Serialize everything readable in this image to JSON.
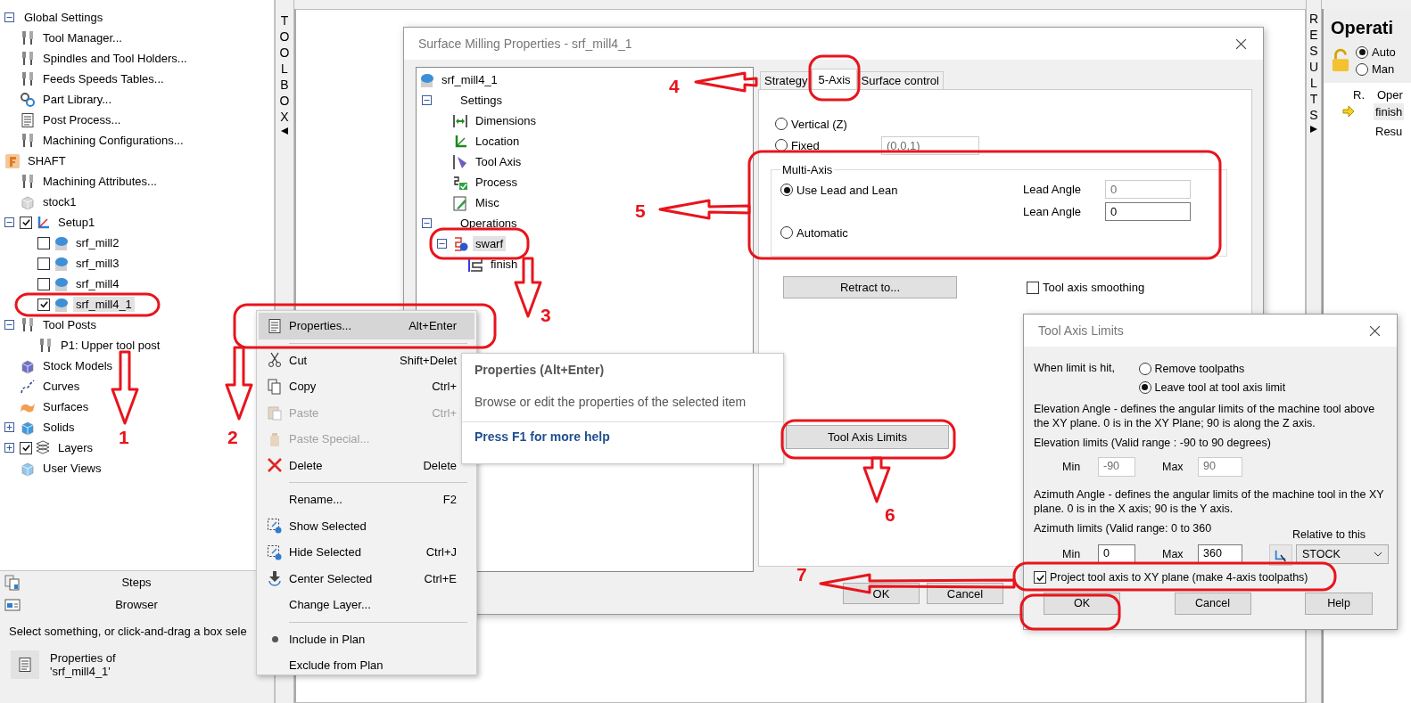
{
  "browser_panel": {
    "tree": [
      {
        "label": "Global Settings",
        "expanded": true,
        "selected": false,
        "children": [
          {
            "label": "Tool Manager...",
            "selected": false
          },
          {
            "label": "Spindles and Tool Holders...",
            "selected": false
          },
          {
            "label": "Feeds  Speeds Tables...",
            "selected": false
          },
          {
            "label": "Part Library...",
            "selected": false
          },
          {
            "label": "Post Process...",
            "selected": false
          },
          {
            "label": "Machining Configurations...",
            "selected": false
          }
        ]
      },
      {
        "label": "SHAFT",
        "selected": false,
        "children": [
          {
            "label": "Machining Attributes...",
            "selected": false
          },
          {
            "label": "stock1",
            "selected": false
          },
          {
            "label": "Setup1",
            "expanded": true,
            "checked": true,
            "selected": false,
            "children": [
              {
                "label": "srf_mill2",
                "checked": false,
                "selected": false
              },
              {
                "label": "srf_mill3",
                "checked": false,
                "selected": false
              },
              {
                "label": "srf_mill4",
                "checked": false,
                "selected": false
              },
              {
                "label": "srf_mill4_1",
                "checked": true,
                "selected": true
              }
            ]
          },
          {
            "label": "Tool Posts",
            "expanded": true,
            "selected": false,
            "children": [
              {
                "label": "P1: Upper tool post",
                "selected": false
              }
            ]
          },
          {
            "label": "Stock Models",
            "selected": false
          },
          {
            "label": "Curves",
            "selected": false
          },
          {
            "label": "Surfaces",
            "selected": false
          },
          {
            "label": "Solids",
            "expanded": false,
            "selected": false
          },
          {
            "label": "Layers",
            "expanded": false,
            "checked": true,
            "selected": false
          },
          {
            "label": "User Views",
            "selected": false
          }
        ]
      }
    ],
    "sections": [
      "Steps",
      "Browser"
    ],
    "status_text": "Select something, or click-and-drag a box sele",
    "properties_button": "Properties of 'srf_mill4_1'"
  },
  "toolbox_strip": {
    "label": "TOOLBOX"
  },
  "results_strip": {
    "label": "RESULTS"
  },
  "operations_panel": {
    "title": "Operati",
    "modes": [
      {
        "label": "Auto",
        "selected": true
      },
      {
        "label": "Man",
        "selected": false
      }
    ],
    "columns": [
      "R.",
      "Oper"
    ],
    "rows": [
      {
        "label": "finish",
        "selected": true
      },
      {
        "label": "Resu",
        "selected": false
      }
    ]
  },
  "properties_dialog": {
    "title": "Surface Milling Properties - srf_mill4_1",
    "tree": [
      {
        "label": "srf_mill4_1",
        "selected": false,
        "children": [
          {
            "label": "Settings",
            "expanded": true,
            "selected": false,
            "children": [
              {
                "label": "Dimensions",
                "selected": false
              },
              {
                "label": "Location",
                "selected": false
              },
              {
                "label": "Tool Axis",
                "selected": false
              },
              {
                "label": "Process",
                "selected": false
              },
              {
                "label": "Misc",
                "selected": false
              }
            ]
          },
          {
            "label": "Operations",
            "expanded": true,
            "selected": false,
            "children": [
              {
                "label": "swarf",
                "expanded": true,
                "selected": true,
                "children": [
                  {
                    "label": "finish",
                    "selected": false
                  }
                ]
              }
            ]
          }
        ]
      }
    ],
    "tabs": [
      {
        "label": "Strategy",
        "selected": false
      },
      {
        "label": "5-Axis",
        "selected": true
      },
      {
        "label": "Surface control",
        "selected": false
      }
    ],
    "axis_options": [
      {
        "label": "Vertical (Z)",
        "selected": false
      },
      {
        "label": "Fixed",
        "selected": false
      }
    ],
    "fixed_vector": {
      "value": "(0,0,1)",
      "disabled": true
    },
    "multi_axis": {
      "title": "Multi-Axis",
      "options": [
        {
          "label": "Use Lead and Lean",
          "selected": true
        },
        {
          "label": "Automatic",
          "selected": false
        }
      ],
      "fields": [
        {
          "label": "Lead Angle",
          "value": "0",
          "disabled": true
        },
        {
          "label": "Lean Angle",
          "value": "0",
          "disabled": false
        }
      ]
    },
    "retract_button": "Retract to...",
    "smoothing": {
      "label": "Tool axis smoothing",
      "checked": false
    },
    "limits_button": "Tool Axis Limits",
    "buttons": [
      "OK",
      "Cancel"
    ]
  },
  "context_menu": {
    "items": [
      {
        "kind": "item",
        "label": "Properties...",
        "shortcut": "Alt+Enter",
        "disabled": false,
        "selected": true
      },
      {
        "kind": "separator"
      },
      {
        "kind": "item",
        "label": "Cut",
        "shortcut": "Shift+Delet",
        "disabled": false,
        "selected": false
      },
      {
        "kind": "item",
        "label": "Copy",
        "shortcut": "Ctrl+",
        "disabled": false,
        "selected": false
      },
      {
        "kind": "item",
        "label": "Paste",
        "shortcut": "Ctrl+",
        "disabled": true,
        "selected": false
      },
      {
        "kind": "item",
        "label": "Paste Special...",
        "disabled": true,
        "selected": false
      },
      {
        "kind": "item",
        "label": "Delete",
        "shortcut": "Delete",
        "disabled": false,
        "selected": false
      },
      {
        "kind": "separator"
      },
      {
        "kind": "item",
        "label": "Rename...",
        "shortcut": "F2",
        "disabled": false,
        "selected": false
      },
      {
        "kind": "item",
        "label": "Show Selected",
        "disabled": false,
        "selected": false
      },
      {
        "kind": "item",
        "label": "Hide Selected",
        "shortcut": "Ctrl+J",
        "disabled": false,
        "selected": false
      },
      {
        "kind": "item",
        "label": "Center Selected",
        "shortcut": "Ctrl+E",
        "disabled": false,
        "selected": false
      },
      {
        "kind": "item",
        "label": "Change Layer...",
        "disabled": false,
        "selected": false
      },
      {
        "kind": "separator"
      },
      {
        "kind": "item",
        "label": "Include in Plan",
        "disabled": false,
        "selected": false
      },
      {
        "kind": "item",
        "label": "Exclude from Plan",
        "disabled": false,
        "selected": false
      }
    ]
  },
  "tooltip": {
    "title": "Properties (Alt+Enter)",
    "text": "Browse or edit the properties of the selected item",
    "help_link": "Press F1 for more help"
  },
  "limits_dialog": {
    "title": "Tool Axis Limits",
    "limit_prompt": "When limit is hit,",
    "limit_options": [
      {
        "label": "Remove toolpaths",
        "selected": false
      },
      {
        "label": "Leave tool at tool axis limit",
        "selected": true
      }
    ],
    "elevation_note": "Elevation Angle - defines the angular limits of the machine tool above the XY plane. 0 is in the XY Plane; 90 is along the Z axis.",
    "elevation_range": "Elevation limits (Valid range : -90 to 90 degrees)",
    "elevation_fields": [
      {
        "label": "Min",
        "value": "-90",
        "disabled": true
      },
      {
        "label": "Max",
        "value": "90",
        "disabled": true
      }
    ],
    "azimuth_note": "Azimuth Angle - defines the angular limits of the machine tool in the XY plane. 0 is in the X axis; 90 is the Y axis.",
    "azimuth_range": "Azimuth limits (Valid range: 0 to 360",
    "azimuth_fields": [
      {
        "label": "Min",
        "value": "0",
        "disabled": false
      },
      {
        "label": "Max",
        "value": "360",
        "disabled": false
      }
    ],
    "relative_label": "Relative to this",
    "relative_value": "STOCK",
    "project": {
      "label": "Project tool axis to XY plane (make 4-axis toolpaths)",
      "checked": true
    },
    "buttons": [
      "OK",
      "Cancel",
      "Help"
    ]
  },
  "annotations": [
    {
      "label": "1"
    },
    {
      "label": "2"
    },
    {
      "label": "3"
    },
    {
      "label": "4"
    },
    {
      "label": "5"
    },
    {
      "label": "6"
    },
    {
      "label": "7"
    }
  ]
}
